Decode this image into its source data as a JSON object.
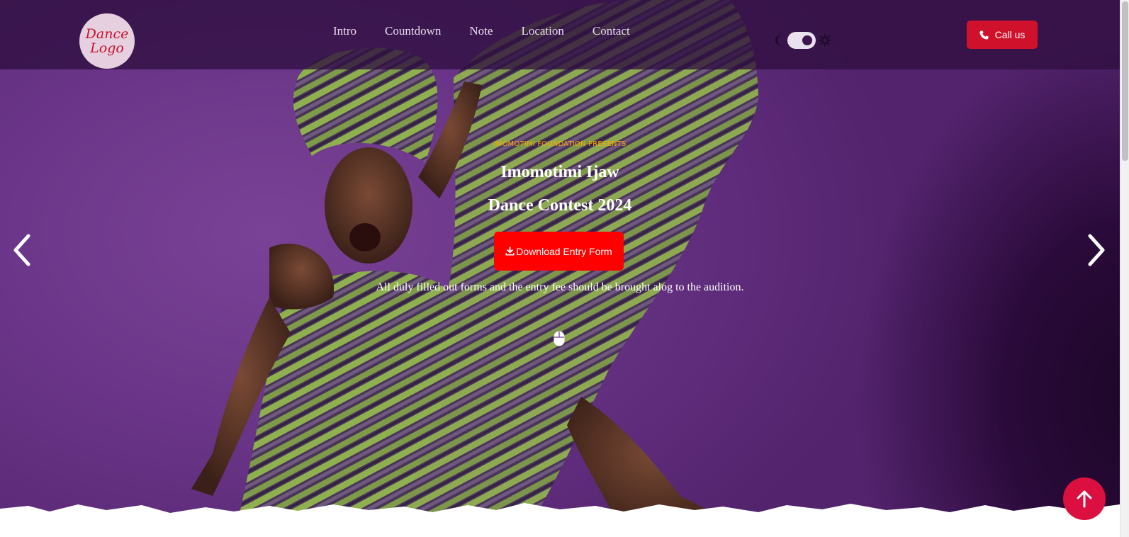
{
  "logo": {
    "line1": "Dance",
    "line2": "Logo"
  },
  "nav": {
    "items": [
      {
        "label": "Intro"
      },
      {
        "label": "Countdown"
      },
      {
        "label": "Note"
      },
      {
        "label": "Location"
      },
      {
        "label": "Contact"
      }
    ]
  },
  "theme_toggle": {
    "moon_icon": "moon-icon",
    "sun_icon": "sun-icon",
    "state": "dark-off"
  },
  "call_button": {
    "label": "Call us",
    "icon": "phone-icon"
  },
  "hero": {
    "eyebrow": "IMOMOTIMI FOUNDATION PRESENTS",
    "title_line1": "Imomotimi Ijaw",
    "title_line2": "Dance Contest 2024",
    "download_label": "Download Entry Form",
    "download_icon": "download-icon",
    "note": "All duly filled out forms and the entry fee should be brought alog to the audition.",
    "scroll_icon": "mouse-icon"
  },
  "carousel": {
    "prev_icon": "chevron-left-icon",
    "next_icon": "chevron-right-icon"
  },
  "back_to_top": {
    "icon": "arrow-up-icon"
  },
  "colors": {
    "accent_red": "#ff0000",
    "call_red": "#d0112b",
    "eyebrow_orange": "#ffa800",
    "hero_purple": "#6a3588",
    "back_to_top": "#dc1040"
  }
}
